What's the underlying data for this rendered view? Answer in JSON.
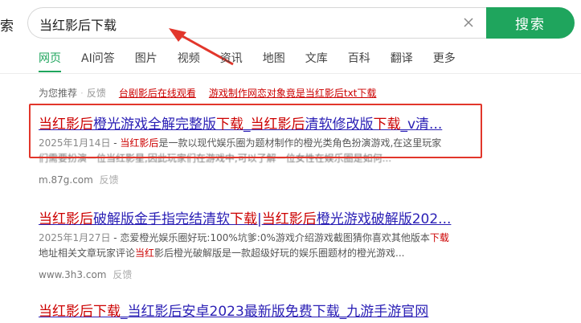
{
  "logo_fragment": "索",
  "search": {
    "query": "当红影后下载",
    "button_label": "搜索"
  },
  "tabs": [
    {
      "label": "网页",
      "active": true
    },
    {
      "label": "AI问答",
      "active": false
    },
    {
      "label": "图片",
      "active": false
    },
    {
      "label": "视频",
      "active": false
    },
    {
      "label": "资讯",
      "active": false
    },
    {
      "label": "地图",
      "active": false
    },
    {
      "label": "文库",
      "active": false
    },
    {
      "label": "百科",
      "active": false
    },
    {
      "label": "翻译",
      "active": false
    },
    {
      "label": "更多",
      "active": false
    }
  ],
  "recommend": {
    "label": "为您推荐",
    "feedback": "反馈",
    "links": [
      "台剧影后在线观看",
      "游戏制作网恋对象竟是当红影后txt下载"
    ]
  },
  "results": [
    {
      "title_parts": [
        {
          "text": "当红影后",
          "hl": true
        },
        {
          "text": "橙光游戏全解完整版",
          "hl": false
        },
        {
          "text": "下载",
          "hl": true
        },
        {
          "text": "_",
          "hl": false
        },
        {
          "text": "当红影后",
          "hl": true
        },
        {
          "text": "清软修改版",
          "hl": false
        },
        {
          "text": "下载",
          "hl": true
        },
        {
          "text": "_v清...",
          "hl": false
        }
      ],
      "date": "2025年1月14日",
      "desc_hl": "当红影后",
      "desc_line1": "是一款以现代娱乐圈为题材制作的橙光类角色扮演游戏,在这里玩家",
      "desc_line2": "们需要扮演一位当红影星,因此玩家们在游戏中,可以了解一位女性在娱乐圈是如何...",
      "source": "m.87g.com",
      "feedback": "反馈"
    },
    {
      "title_parts": [
        {
          "text": "当红影后",
          "hl": true
        },
        {
          "text": "破解版金手指完结清软",
          "hl": false
        },
        {
          "text": "下载",
          "hl": true
        },
        {
          "text": "|",
          "hl": false
        },
        {
          "text": "当红影后",
          "hl": true
        },
        {
          "text": "橙光游戏破解版202...",
          "hl": false
        }
      ],
      "date": "2025年1月27日",
      "desc_line1": "恋爱橙光娱乐圈好玩:100%坑爹:0%游戏介绍游戏截图猜你喜欢其他版本",
      "desc_line1_hl": "下载",
      "desc_line2_pre": "地址相关文章玩家评论",
      "desc_line2_hl": "当红",
      "desc_line2_post": "影后橙光破解版是一款超级好玩的娱乐圈题材的橙光游戏...",
      "source": "www.3h3.com",
      "feedback": "反馈"
    },
    {
      "title_parts": [
        {
          "text": "当红影后下载",
          "hl": true
        },
        {
          "text": "_当红影后安卓2023最新版免费下载_九游手游官网",
          "hl": false
        }
      ]
    }
  ],
  "colors": {
    "accent": "#1fa55d",
    "highlight": "#cc0000",
    "annotation": "#e2362b"
  }
}
